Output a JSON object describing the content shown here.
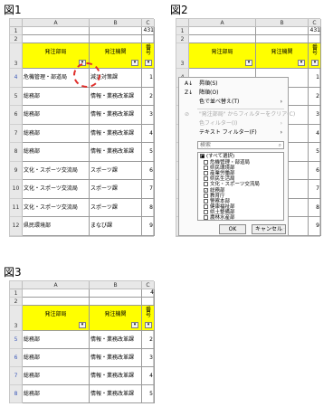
{
  "figures": {
    "fig1_label": "図1",
    "fig2_label": "図2",
    "fig3_label": "図3"
  },
  "sheet": {
    "col_a": "A",
    "col_b": "B",
    "col_c": "C",
    "row1_value": "431",
    "row1_value_fig3": "4",
    "header_a": "発注部局",
    "header_b": "発注機関",
    "header_c": "番号",
    "filter_arrow": "▾",
    "filtered_arrow": "▾"
  },
  "fig1_rows": [
    {
      "row": "1",
      "a": "",
      "b": "",
      "c": ""
    },
    {
      "row": "2",
      "a": "",
      "b": "",
      "c": ""
    },
    {
      "row": "3",
      "a": "",
      "b": "",
      "c": ""
    },
    {
      "row": "4",
      "a": "危機管理・部道局",
      "b": "減災対策課",
      "c": "1"
    },
    {
      "row": "5",
      "a": "総務部",
      "b": "情報・業務改革課",
      "c": "2"
    },
    {
      "row": "6",
      "a": "総務部",
      "b": "情報・業務改革課",
      "c": "3"
    },
    {
      "row": "7",
      "a": "総務部",
      "b": "情報・業務改革課",
      "c": "4"
    },
    {
      "row": "8",
      "a": "総務部",
      "b": "情報・業務改革課",
      "c": "5"
    },
    {
      "row": "9",
      "a": "文化・スポーツ交流局",
      "b": "スポーツ課",
      "c": "6"
    },
    {
      "row": "10",
      "a": "文化・スポーツ交流局",
      "b": "スポーツ課",
      "c": "7"
    },
    {
      "row": "11",
      "a": "文化・スポーツ交流局",
      "b": "スポーツ課",
      "c": "8"
    },
    {
      "row": "12",
      "a": "県民環境部",
      "b": "まなび課",
      "c": "9"
    }
  ],
  "fig2_rows": [
    "1",
    "2",
    "3",
    "4",
    "5",
    "6",
    "7",
    "8",
    "9",
    "10",
    "11",
    "12"
  ],
  "fig2_c_values": [
    "1",
    "2",
    "3",
    "4",
    "5",
    "6",
    "7",
    "8",
    "9"
  ],
  "menu": {
    "sort_asc": "昇順(S)",
    "sort_desc": "降順(O)",
    "sort_color": "色で並べ替え(T)",
    "clear_filter": "\"発注部局\" からフィルターをクリア(C)",
    "color_filter": "色フィルター(I)",
    "text_filter": "テキスト フィルター(F)",
    "search_placeholder": "検索",
    "select_all": "(すべて選択)",
    "items": [
      {
        "label": "危機管理・部道局",
        "checked": false
      },
      {
        "label": "県民環境部",
        "checked": false
      },
      {
        "label": "産業労働部",
        "checked": false
      },
      {
        "label": "県民生活局",
        "checked": false
      },
      {
        "label": "文化・スポーツ交流局",
        "checked": false
      },
      {
        "label": "総務部",
        "checked": true
      },
      {
        "label": "教育庁",
        "checked": false
      },
      {
        "label": "警察本部",
        "checked": false
      },
      {
        "label": "健康福祉部",
        "checked": false
      },
      {
        "label": "県土整備部",
        "checked": false
      },
      {
        "label": "農林水産部",
        "checked": false
      }
    ],
    "ok": "OK",
    "cancel": "キャンセル"
  },
  "fig3_rows": [
    {
      "row": "5",
      "a": "総務部",
      "b": "情報・業務改革課",
      "c": "2"
    },
    {
      "row": "6",
      "a": "総務部",
      "b": "情報・業務改革課",
      "c": "3"
    },
    {
      "row": "7",
      "a": "総務部",
      "b": "情報・業務改革課",
      "c": "4"
    },
    {
      "row": "8",
      "a": "総務部",
      "b": "情報・業務改革課",
      "c": "5"
    }
  ],
  "colors": {
    "header_fill": "#ffff00",
    "highlight_circle": "#e0302c",
    "filtered_row_number": "#3a57b8"
  }
}
